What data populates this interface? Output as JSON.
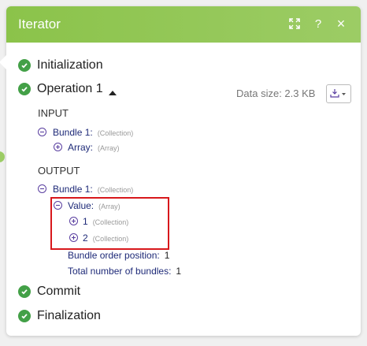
{
  "header": {
    "title": "Iterator",
    "expand_icon": "expand-icon",
    "help_label": "?",
    "close_label": "×"
  },
  "steps": {
    "initialization": "Initialization",
    "operation": "Operation 1",
    "commit": "Commit",
    "finalization": "Finalization"
  },
  "operation": {
    "data_size": "Data size: 2.3 KB",
    "input_label": "INPUT",
    "output_label": "OUTPUT",
    "input_tree": {
      "bundle": {
        "key": "Bundle 1:",
        "type": "(Collection)"
      },
      "array": {
        "key": "Array:",
        "type": "(Array)"
      }
    },
    "output_tree": {
      "bundle": {
        "key": "Bundle 1:",
        "type": "(Collection)"
      },
      "value": {
        "key": "Value:",
        "type": "(Array)"
      },
      "item1": {
        "key": "1",
        "type": "(Collection)"
      },
      "item2": {
        "key": "2",
        "type": "(Collection)"
      },
      "order": {
        "key": "Bundle order position:",
        "val": "1"
      },
      "total": {
        "key": "Total number of bundles:",
        "val": "1"
      }
    }
  },
  "colors": {
    "header_green": "#8bc34a",
    "check_green": "#43a047",
    "highlight_red": "#d8181c"
  }
}
